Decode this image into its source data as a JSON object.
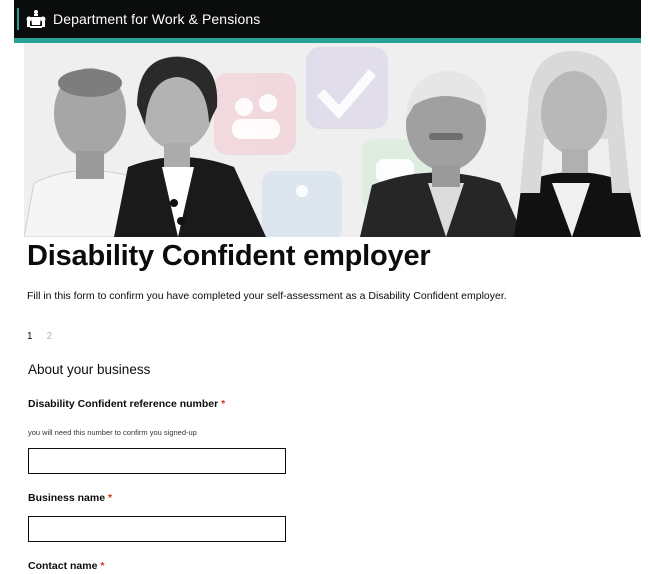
{
  "header": {
    "department": "Department for Work & Pensions"
  },
  "hero": {
    "people_count": 4
  },
  "page": {
    "title": "Disability Confident employer",
    "intro": "Fill in this form to confirm you have completed your self-assessment as a Disability Confident employer."
  },
  "steps": [
    "1",
    "2"
  ],
  "form": {
    "section_title": "About your business",
    "fields": [
      {
        "label": "Disability Confident reference number",
        "required_marker": "*",
        "hint": "you will need this number to confirm you signed-up",
        "value": ""
      },
      {
        "label": "Business name",
        "required_marker": "*",
        "value": ""
      },
      {
        "label": "Contact name",
        "required_marker": "*"
      }
    ]
  },
  "colors": {
    "header_bg": "#0b0c0c",
    "accent": "#28a197",
    "required": "#d4351c"
  }
}
